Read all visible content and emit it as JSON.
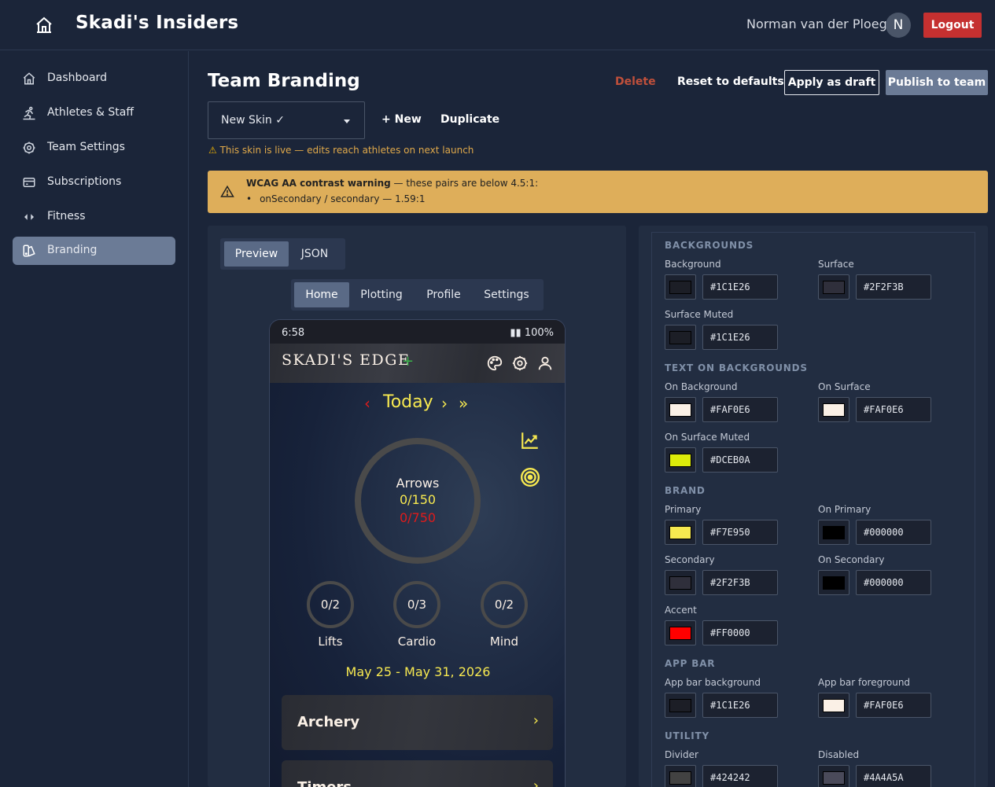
{
  "app": {
    "title": "Skadi's Insiders",
    "user_name": "Norman van der Ploeg",
    "avatar_initial": "N",
    "logout_label": "Logout"
  },
  "sidebar": {
    "items": [
      {
        "label": "Dashboard",
        "icon": "home-icon"
      },
      {
        "label": "Athletes & Staff",
        "icon": "athlete-icon"
      },
      {
        "label": "Team Settings",
        "icon": "gear-icon"
      },
      {
        "label": "Subscriptions",
        "icon": "card-icon"
      },
      {
        "label": "Fitness",
        "icon": "code-icon"
      },
      {
        "label": "Branding",
        "icon": "palette-icon",
        "active": true
      }
    ]
  },
  "header": {
    "title": "Team Branding",
    "delete_label": "Delete",
    "reset_label": "Reset to defaults",
    "draft_label": "Apply as draft",
    "publish_label": "Publish to team"
  },
  "skin": {
    "selected": "New Skin ✓",
    "new_label": "+ New",
    "duplicate_label": "Duplicate",
    "live_note": "This skin is live — edits reach athletes on next launch"
  },
  "warning": {
    "title": "WCAG AA contrast warning",
    "subtitle": " — these pairs are below 4.5:1:",
    "items": [
      "onSecondary / secondary — 1.59:1"
    ]
  },
  "preview": {
    "mode_tabs": [
      "Preview",
      "JSON"
    ],
    "active_mode": "Preview",
    "screen_tabs": [
      "Home",
      "Plotting",
      "Profile",
      "Settings"
    ],
    "active_screen": "Home",
    "phone": {
      "time": "6:58",
      "battery": "▮▮ 100%",
      "brand": "SKADI'S EDGE",
      "plus": "+",
      "today": "Today",
      "nav_prev": "‹",
      "nav_next": "›",
      "nav_next2": "»",
      "ring_label": "Arrows",
      "ring_value_1": "0/150",
      "ring_value_2": "0/750",
      "small_rings": [
        {
          "value": "0/2",
          "label": "Lifts"
        },
        {
          "value": "0/3",
          "label": "Cardio"
        },
        {
          "value": "0/2",
          "label": "Mind"
        }
      ],
      "date_range": "May 25 - May 31, 2026",
      "cards": [
        "Archery",
        "Timers"
      ],
      "chevron": "›"
    }
  },
  "colors": {
    "sections": {
      "backgrounds": "BACKGROUNDS",
      "text": "TEXT ON BACKGROUNDS",
      "brand": "BRAND",
      "appbar": "APP BAR",
      "utility": "UTILITY"
    },
    "fields": [
      {
        "label": "Background",
        "hex": "#1C1E26",
        "color": "#1C1E26"
      },
      {
        "label": "Surface",
        "hex": "#2F2F3B",
        "color": "#2F2F3B"
      },
      {
        "label": "Surface Muted",
        "hex": "#1C1E26",
        "color": "#1C1E26"
      },
      {
        "label": "On Background",
        "hex": "#FAF0E6",
        "color": "#FAF0E6"
      },
      {
        "label": "On Surface",
        "hex": "#FAF0E6",
        "color": "#FAF0E6"
      },
      {
        "label": "On Surface Muted",
        "hex": "#DCEB0A",
        "color": "#DCEB0A"
      },
      {
        "label": "Primary",
        "hex": "#F7E950",
        "color": "#F7E950"
      },
      {
        "label": "On Primary",
        "hex": "#000000",
        "color": "#000000"
      },
      {
        "label": "Secondary",
        "hex": "#2F2F3B",
        "color": "#2F2F3B"
      },
      {
        "label": "On Secondary",
        "hex": "#000000",
        "color": "#000000"
      },
      {
        "label": "Accent",
        "hex": "#FF0000",
        "color": "#FF0000"
      },
      {
        "label": "App bar background",
        "hex": "#1C1E26",
        "color": "#1C1E26"
      },
      {
        "label": "App bar foreground",
        "hex": "#FAF0E6",
        "color": "#FAF0E6"
      },
      {
        "label": "Divider",
        "hex": "#424242",
        "color": "#424242"
      },
      {
        "label": "Disabled",
        "hex": "#4A4A5A",
        "color": "#4A4A5A"
      }
    ]
  }
}
